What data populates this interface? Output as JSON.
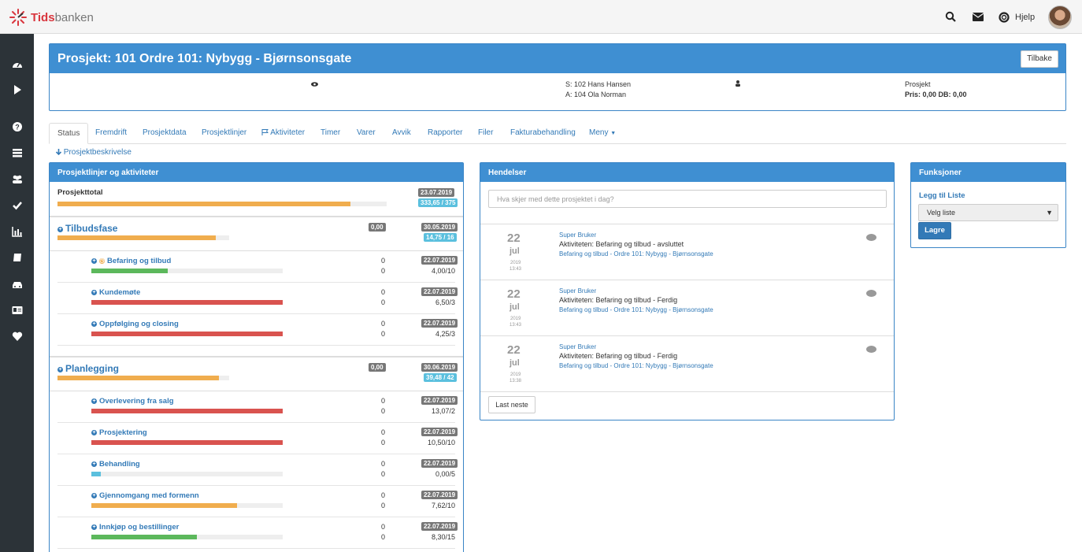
{
  "app": {
    "logo_bold": "Tids",
    "logo_rest": "banken",
    "help_label": "Hjelp"
  },
  "colors": {
    "primary": "#3f8fd2",
    "sidebar": "#2c3338",
    "orange": "#f0ad4e",
    "green": "#5cb85c",
    "red": "#d9534f",
    "cyan": "#5bc0de"
  },
  "project": {
    "title": "Prosjekt: 101 Ordre 101: Nybygg - Bjørnsonsgate",
    "back_label": "Tilbake",
    "seller": "S: 102 Hans Hansen",
    "assignee": "A: 104 Ola Norman",
    "type_label": "Prosjekt",
    "price_line": "Pris: 0,00 DB: 0,00"
  },
  "tabs": [
    "Status",
    "Fremdrift",
    "Prosjektdata",
    "Prosjektlinjer",
    "Aktiviteter",
    "Timer",
    "Varer",
    "Avvik",
    "Rapporter",
    "Filer",
    "Fakturabehandling",
    "Meny"
  ],
  "description_link": "Prosjektbeskrivelse",
  "lines_panel": {
    "title": "Prosjektlinjer og aktiviteter",
    "total": {
      "label": "Prosjekttotal",
      "date": "23.07.2019",
      "hours": "333,65 / 375",
      "progress": 0.89
    },
    "phases": [
      {
        "name": "Tilbudsfase",
        "badge": "0,00",
        "date": "30.05.2019",
        "hours": "14,75 / 16",
        "progress": 0.92,
        "activities": [
          {
            "name": "Befaring og tilbud",
            "val1": "0",
            "val2": "0",
            "date": "22.07.2019",
            "hours": "4,00/10",
            "progress": 0.4,
            "color": "green"
          },
          {
            "name": "Kundemøte",
            "val1": "0",
            "val2": "0",
            "date": "22.07.2019",
            "hours": "6,50/3",
            "progress": 1.0,
            "color": "red"
          },
          {
            "name": "Oppfølging og closing",
            "val1": "0",
            "val2": "0",
            "date": "22.07.2019",
            "hours": "4,25/3",
            "progress": 1.0,
            "color": "red"
          }
        ]
      },
      {
        "name": "Planlegging",
        "badge": "0,00",
        "date": "30.06.2019",
        "hours": "39,48 / 42",
        "progress": 0.94,
        "activities": [
          {
            "name": "Overlevering fra salg",
            "val1": "0",
            "val2": "0",
            "date": "22.07.2019",
            "hours": "13,07/2",
            "progress": 1.0,
            "color": "red"
          },
          {
            "name": "Prosjektering",
            "val1": "0",
            "val2": "0",
            "date": "22.07.2019",
            "hours": "10,50/10",
            "progress": 1.0,
            "color": "red"
          },
          {
            "name": "Behandling",
            "val1": "0",
            "val2": "0",
            "date": "22.07.2019",
            "hours": "0,00/5",
            "progress": 0.05,
            "color": "cyan"
          },
          {
            "name": "Gjennomgang med formenn",
            "val1": "0",
            "val2": "0",
            "date": "22.07.2019",
            "hours": "7,62/10",
            "progress": 0.76,
            "color": "orange"
          },
          {
            "name": "Innkjøp og bestillinger",
            "val1": "0",
            "val2": "0",
            "date": "22.07.2019",
            "hours": "8,30/15",
            "progress": 0.55,
            "color": "green"
          }
        ]
      }
    ]
  },
  "events_panel": {
    "title": "Hendelser",
    "input_placeholder": "Hva skjer med dette prosjektet i dag?",
    "events": [
      {
        "day": "22",
        "month": "jul",
        "year": "2019",
        "time": "13:43",
        "user": "Super Bruker",
        "text": "Aktiviteten: Befaring og tilbud - avsluttet",
        "link": "Befaring og tilbud - Ordre 101: Nybygg - Bjørnsonsgate"
      },
      {
        "day": "22",
        "month": "jul",
        "year": "2019",
        "time": "13:43",
        "user": "Super Bruker",
        "text": "Aktiviteten: Befaring og tilbud - Ferdig",
        "link": "Befaring og tilbud - Ordre 101: Nybygg - Bjørnsonsgate"
      },
      {
        "day": "22",
        "month": "jul",
        "year": "2019",
        "time": "13:38",
        "user": "Super Bruker",
        "text": "Aktiviteten: Befaring og tilbud - Ferdig",
        "link": "Befaring og tilbud - Ordre 101: Nybygg - Bjørnsonsgate"
      }
    ],
    "load_more": "Last neste"
  },
  "functions_panel": {
    "title": "Funksjoner",
    "add_to_list": "Legg til Liste",
    "select_value": "Velg liste",
    "save": "Lagre"
  }
}
